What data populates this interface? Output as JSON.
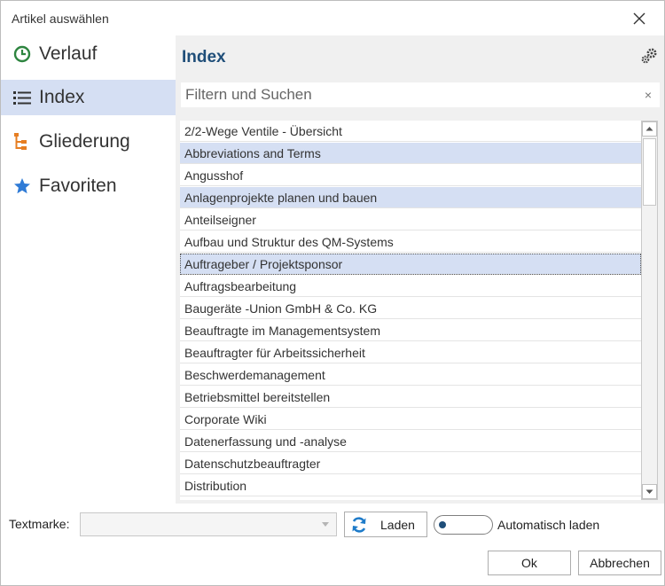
{
  "dialog": {
    "title": "Artikel auswählen"
  },
  "sidebar": {
    "items": [
      {
        "label": "Verlauf",
        "icon": "clock-icon",
        "color": "#2e8540"
      },
      {
        "label": "Index",
        "icon": "list-icon",
        "color": "#333333"
      },
      {
        "label": "Gliederung",
        "icon": "outline-tree-icon",
        "color": "#e67e22"
      },
      {
        "label": "Favoriten",
        "icon": "star-icon",
        "color": "#2f7bd6"
      }
    ],
    "active_index": 1
  },
  "main": {
    "title": "Index",
    "search": {
      "placeholder": "Filtern und Suchen",
      "value": "",
      "clear_glyph": "×"
    },
    "items": [
      "2/2-Wege Ventile - Übersicht",
      "Abbreviations and Terms",
      "Angusshof",
      "Anlagenprojekte planen und bauen",
      "Anteilseigner",
      "Aufbau und Struktur des QM-Systems",
      "Auftrageber / Projektsponsor",
      "Auftragsbearbeitung",
      "Baugeräte -Union GmbH & Co. KG",
      "Beauftragte im Managementsystem",
      "Beauftragter für Arbeitssicherheit",
      "Beschwerdemanagement",
      "Betriebsmittel bereitstellen",
      "Corporate Wiki",
      "Datenerfassung und -analyse",
      "Datenschutzbeauftragter",
      "Distribution"
    ],
    "highlighted_items": [
      1,
      3
    ],
    "selected_item": 6
  },
  "footer": {
    "textmarke_label": "Textmarke:",
    "textmarke_value": "",
    "laden_label": "Laden",
    "auto_label": "Automatisch laden",
    "auto_enabled": false,
    "ok_label": "Ok",
    "cancel_label": "Abbrechen"
  },
  "colors": {
    "accent": "#1f4e79",
    "selection": "#d5dff3",
    "refresh": "#1e7bc9"
  }
}
